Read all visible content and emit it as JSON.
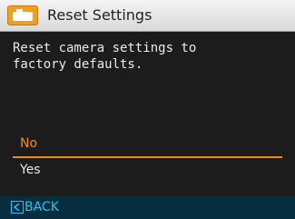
{
  "header": {
    "title": "Reset Settings",
    "icon": "camera-settings-icon",
    "icon_color": "#f0a020"
  },
  "message": {
    "lines": [
      "Reset camera settings to",
      "factory defaults."
    ]
  },
  "options": [
    {
      "label": "No",
      "selected": true
    },
    {
      "label": "Yes",
      "selected": false
    }
  ],
  "footer": {
    "back_label": "BACK",
    "back_icon": "left-arrow-icon"
  },
  "colors": {
    "accent": "#f08a1c",
    "back": "#27c1ef",
    "footer_bg": "#062e3e"
  }
}
